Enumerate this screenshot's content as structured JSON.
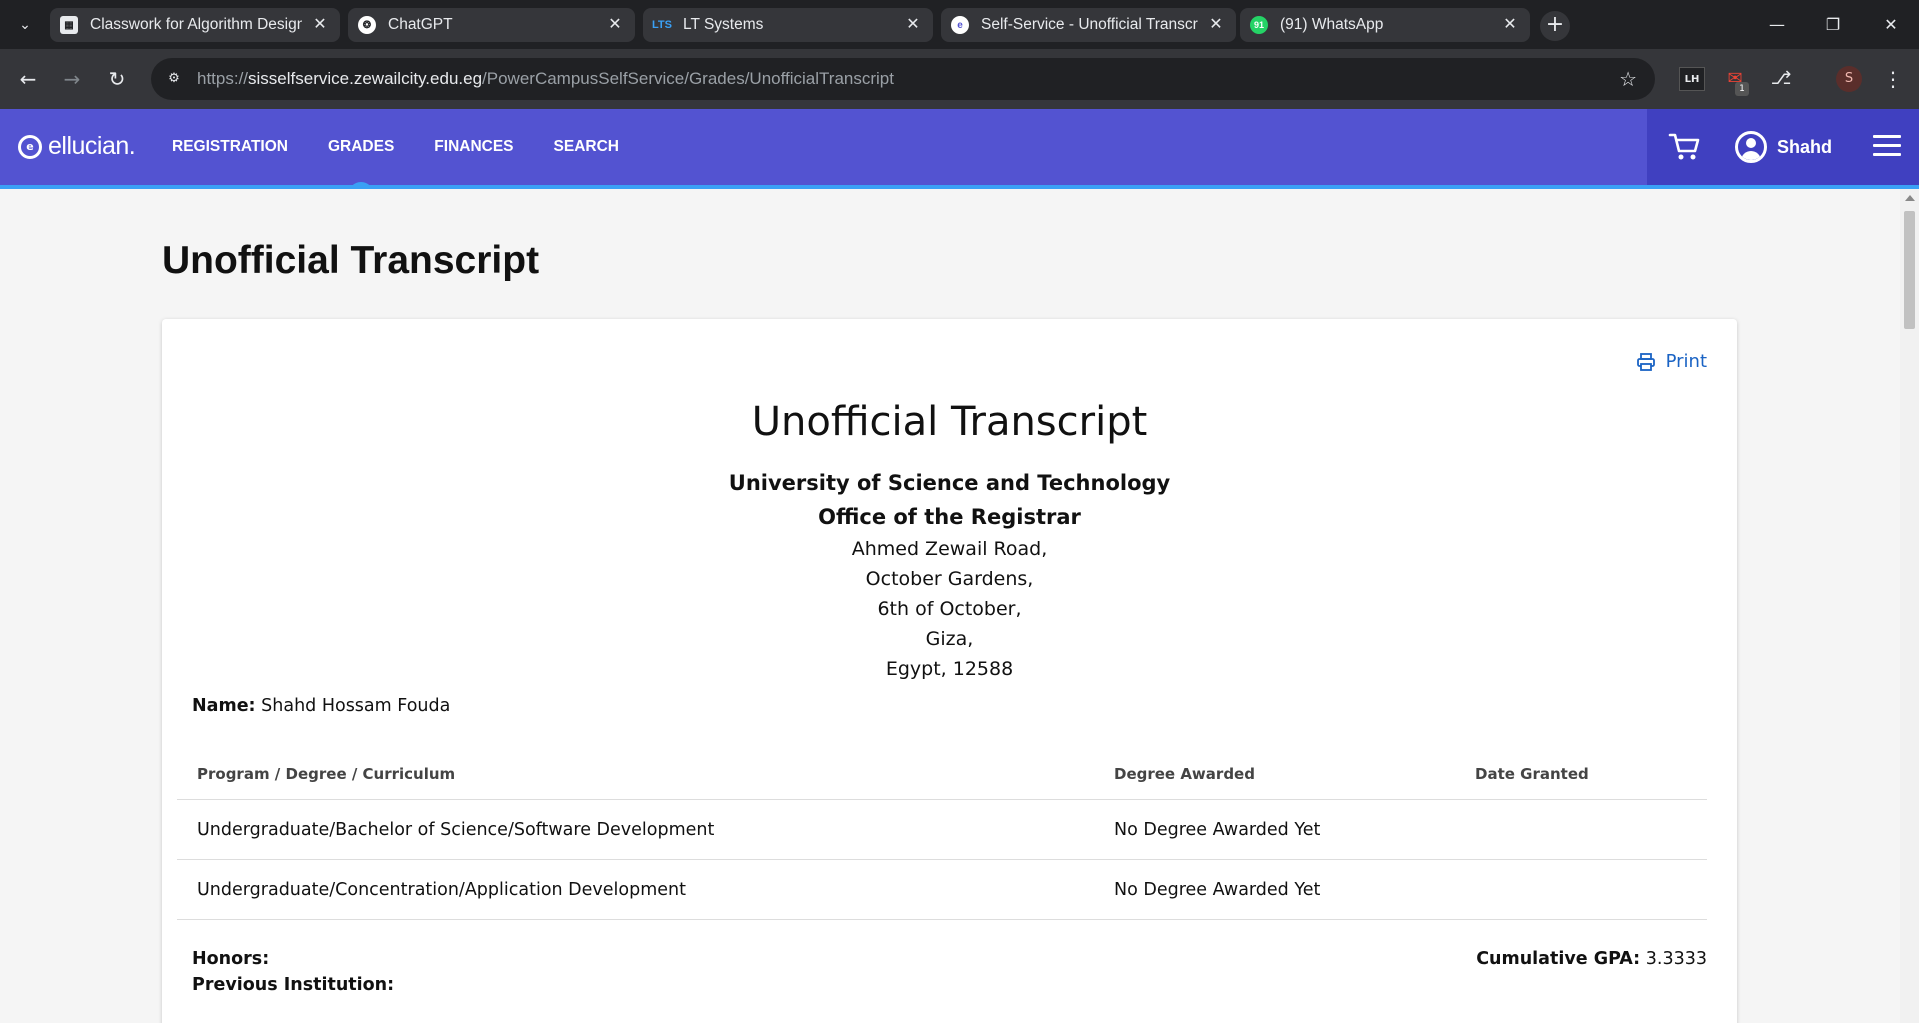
{
  "browser": {
    "tabs": [
      {
        "title": "Classwork for Algorithm Design",
        "icon": "classroom-icon"
      },
      {
        "title": "ChatGPT",
        "icon": "chatgpt-icon"
      },
      {
        "title": "LT Systems",
        "icon": "lts-icon",
        "icon_text": "LTS"
      },
      {
        "title": "Self-Service - Unofficial Transcri",
        "icon": "ellucian-icon"
      },
      {
        "title": "(91) WhatsApp",
        "icon": "whatsapp-icon",
        "icon_text": "91"
      }
    ],
    "url_prefix": "https://",
    "url_host": "sisselfservice.zewailcity.edu.eg",
    "url_path": "/PowerCampusSelfService/Grades/UnofficialTranscript",
    "profile_initial": "S",
    "extension_badge": "1",
    "ext_lh_label": "LH"
  },
  "header": {
    "logo_text": "ellucian.",
    "nav": [
      "REGISTRATION",
      "GRADES",
      "FINANCES",
      "SEARCH"
    ],
    "active_nav": "GRADES",
    "user_name": "Shahd",
    "brand_color": "#5353d1",
    "accent_color": "#3aa0f5"
  },
  "page": {
    "title": "Unofficial Transcript"
  },
  "transcript": {
    "print_label": "Print",
    "title": "Unofficial Transcript",
    "institution": "University of Science and Technology",
    "office": "Office of the Registrar",
    "address": [
      "Ahmed Zewail Road,",
      "October Gardens,",
      "6th of October,",
      "Giza,",
      "Egypt, 12588"
    ],
    "name_label": "Name:",
    "name_value": "Shahd Hossam Fouda",
    "table": {
      "headers": [
        "Program / Degree / Curriculum",
        "Degree Awarded",
        "Date Granted"
      ],
      "rows": [
        {
          "program": "Undergraduate/Bachelor of Science/Software Development",
          "degree": "No Degree Awarded Yet",
          "date": ""
        },
        {
          "program": "Undergraduate/Concentration/Application Development",
          "degree": "No Degree Awarded Yet",
          "date": ""
        }
      ]
    },
    "honors_label": "Honors:",
    "previous_institution_label": "Previous Institution:",
    "gpa_label": "Cumulative GPA:",
    "gpa_value": "3.3333"
  }
}
